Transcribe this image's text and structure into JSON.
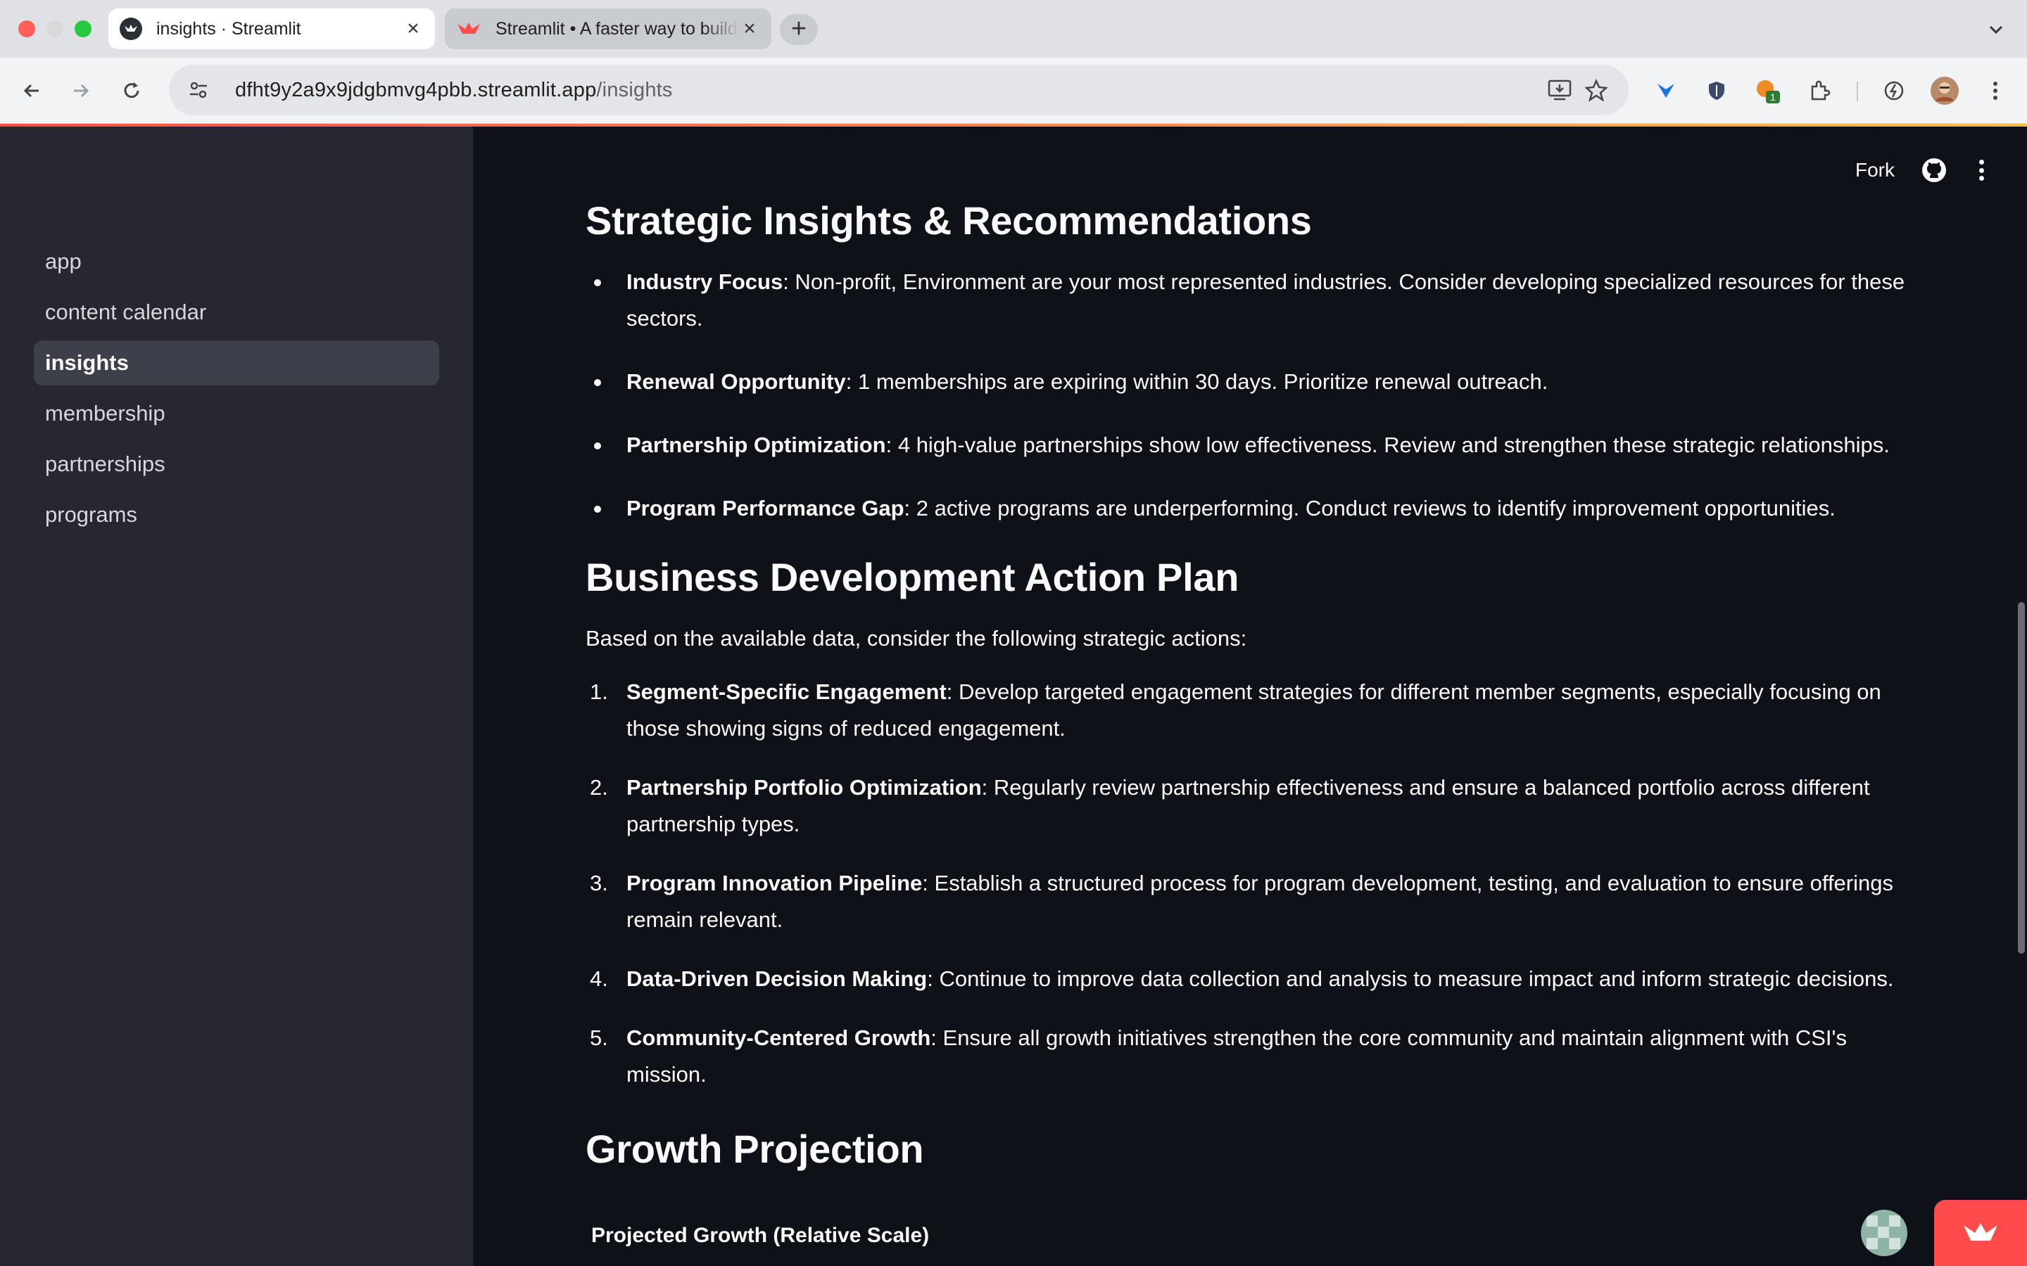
{
  "browser": {
    "tabs": [
      {
        "title": "insights · Streamlit",
        "active": true
      },
      {
        "title": "Streamlit • A faster way to build and share data apps",
        "active": false
      }
    ],
    "url_host": "dfht9y2a9x9jdgbmvg4pbb.streamlit.app",
    "url_path": "/insights",
    "extension_badge": "1"
  },
  "sidebar": {
    "items": [
      {
        "label": "app",
        "active": false
      },
      {
        "label": "content calendar",
        "active": false
      },
      {
        "label": "insights",
        "active": true
      },
      {
        "label": "membership",
        "active": false
      },
      {
        "label": "partnerships",
        "active": false
      },
      {
        "label": "programs",
        "active": false
      }
    ]
  },
  "header": {
    "fork_label": "Fork"
  },
  "insights": {
    "title": "Strategic Insights & Recommendations",
    "items": [
      {
        "bold": "Industry Focus",
        "text": ": Non-profit, Environment are your most represented industries. Consider developing specialized resources for these sectors."
      },
      {
        "bold": "Renewal Opportunity",
        "text": ": 1 memberships are expiring within 30 days. Prioritize renewal outreach."
      },
      {
        "bold": "Partnership Optimization",
        "text": ": 4 high-value partnerships show low effectiveness. Review and strengthen these strategic relationships."
      },
      {
        "bold": "Program Performance Gap",
        "text": ": 2 active programs are underperforming. Conduct reviews to identify improvement opportunities."
      }
    ]
  },
  "action_plan": {
    "title": "Business Development Action Plan",
    "intro": "Based on the available data, consider the following strategic actions:",
    "items": [
      {
        "num": "1.",
        "bold": "Segment-Specific Engagement",
        "text": ": Develop targeted engagement strategies for different member segments, especially focusing on those showing signs of reduced engagement."
      },
      {
        "num": "2.",
        "bold": "Partnership Portfolio Optimization",
        "text": ": Regularly review partnership effectiveness and ensure a balanced portfolio across different partnership types."
      },
      {
        "num": "3.",
        "bold": "Program Innovation Pipeline",
        "text": ": Establish a structured process for program development, testing, and evaluation to ensure offerings remain relevant."
      },
      {
        "num": "4.",
        "bold": "Data-Driven Decision Making",
        "text": ": Continue to improve data collection and analysis to measure impact and inform strategic decisions."
      },
      {
        "num": "5.",
        "bold": "Community-Centered Growth",
        "text": ": Ensure all growth initiatives strengthen the core community and maintain alignment with CSI's mission."
      }
    ]
  },
  "growth": {
    "title": "Growth Projection",
    "chart_title": "Projected Growth (Relative Scale)"
  },
  "colors": {
    "accent": "#ff4b4b",
    "accent_secondary": "#ffbd45",
    "background": "#0e1117",
    "sidebar": "#262730",
    "sidebar_active": "#3d3f4b"
  }
}
